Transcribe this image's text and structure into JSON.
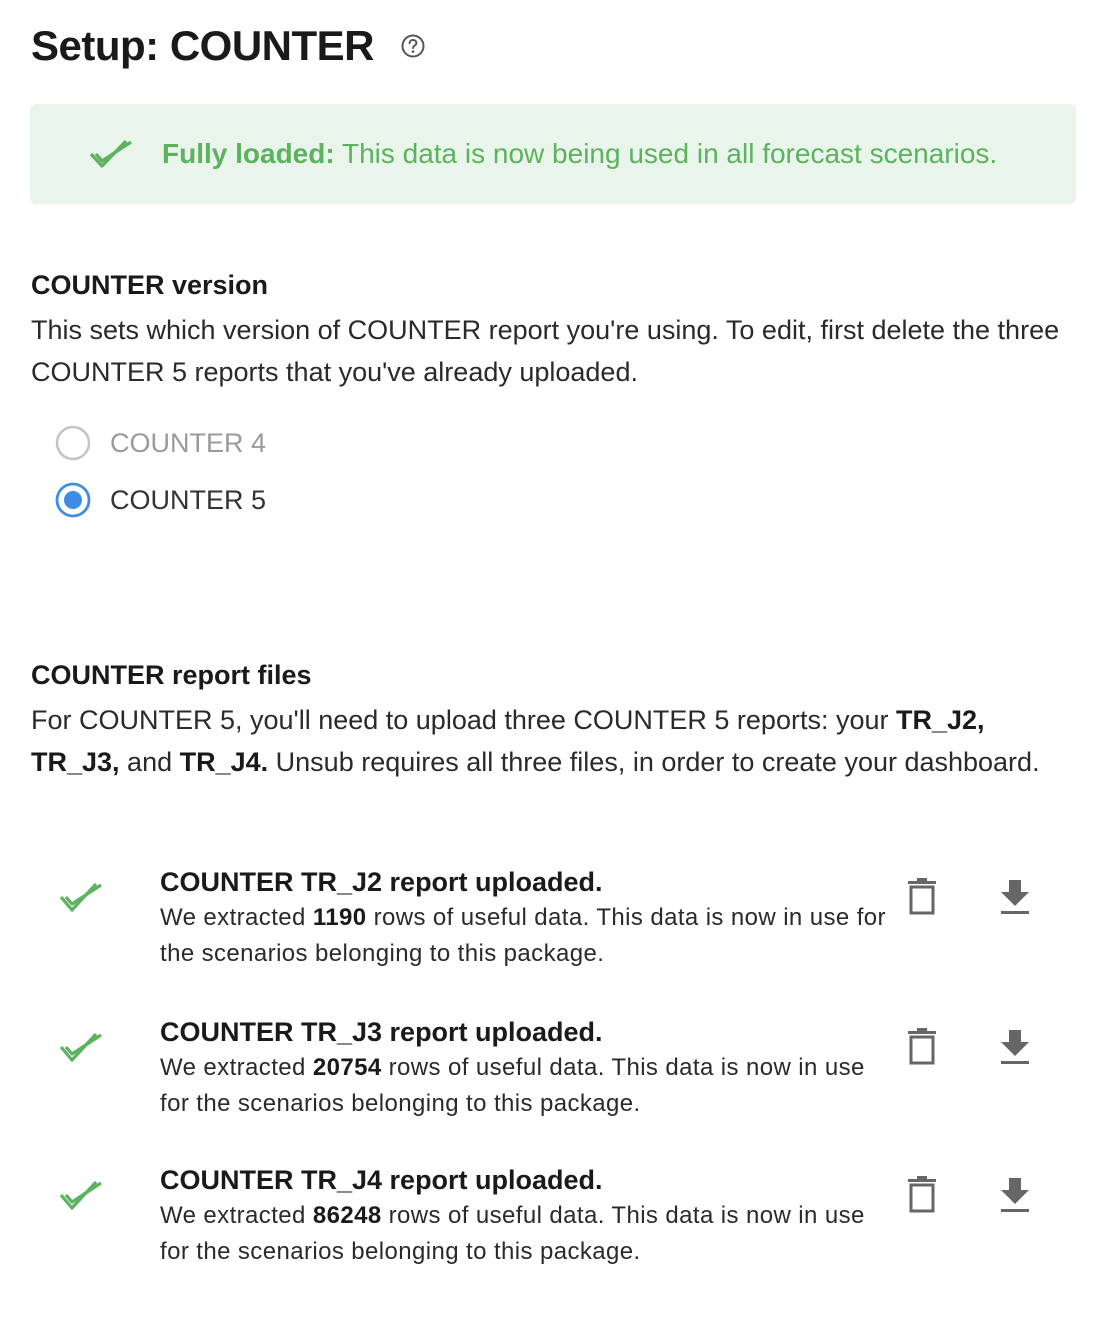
{
  "header": {
    "title": "Setup: COUNTER"
  },
  "alert": {
    "strong": "Fully loaded:",
    "message": " This data is now being used in all forecast scenarios."
  },
  "version_section": {
    "heading": "COUNTER version",
    "description": "This sets which version of COUNTER report you're using. To edit, first delete the three COUNTER 5 reports that you've already uploaded.",
    "options": [
      {
        "label": "COUNTER 4",
        "selected": false,
        "disabled": true
      },
      {
        "label": "COUNTER 5",
        "selected": true,
        "disabled": false
      }
    ]
  },
  "files_section": {
    "heading": "COUNTER report files",
    "desc_1": "For COUNTER 5, you'll need to upload three COUNTER 5 reports: your ",
    "file_a": "TR_J2,",
    "file_b": "TR_J3,",
    "desc_2": " and ",
    "file_c": "TR_J4.",
    "desc_3": " Unsub requires all three files, in order to create your dashboard.",
    "files": [
      {
        "title": "COUNTER TR_J2 report uploaded.",
        "desc_prefix": "We extracted ",
        "rows": "1190",
        "desc_suffix": " rows of useful data. This data is now in use for the scenarios belonging to this package."
      },
      {
        "title": "COUNTER TR_J3 report uploaded.",
        "desc_prefix": "We extracted ",
        "rows": "20754",
        "desc_suffix": " rows of useful data. This data is now in use for the scenarios belonging to this package."
      },
      {
        "title": "COUNTER TR_J4 report uploaded.",
        "desc_prefix": "We extracted ",
        "rows": "86248",
        "desc_suffix": " rows of useful data. This data is now in use for the scenarios belonging to this package."
      }
    ]
  },
  "colors": {
    "success_green": "#5cb25f",
    "alert_bg": "#e9f4ea",
    "radio_blue": "#3d8de6",
    "icon_gray": "#666666"
  },
  "icons": {
    "help": "help-circle-icon",
    "check": "check-double-icon",
    "delete": "trash-icon",
    "download": "download-icon"
  }
}
